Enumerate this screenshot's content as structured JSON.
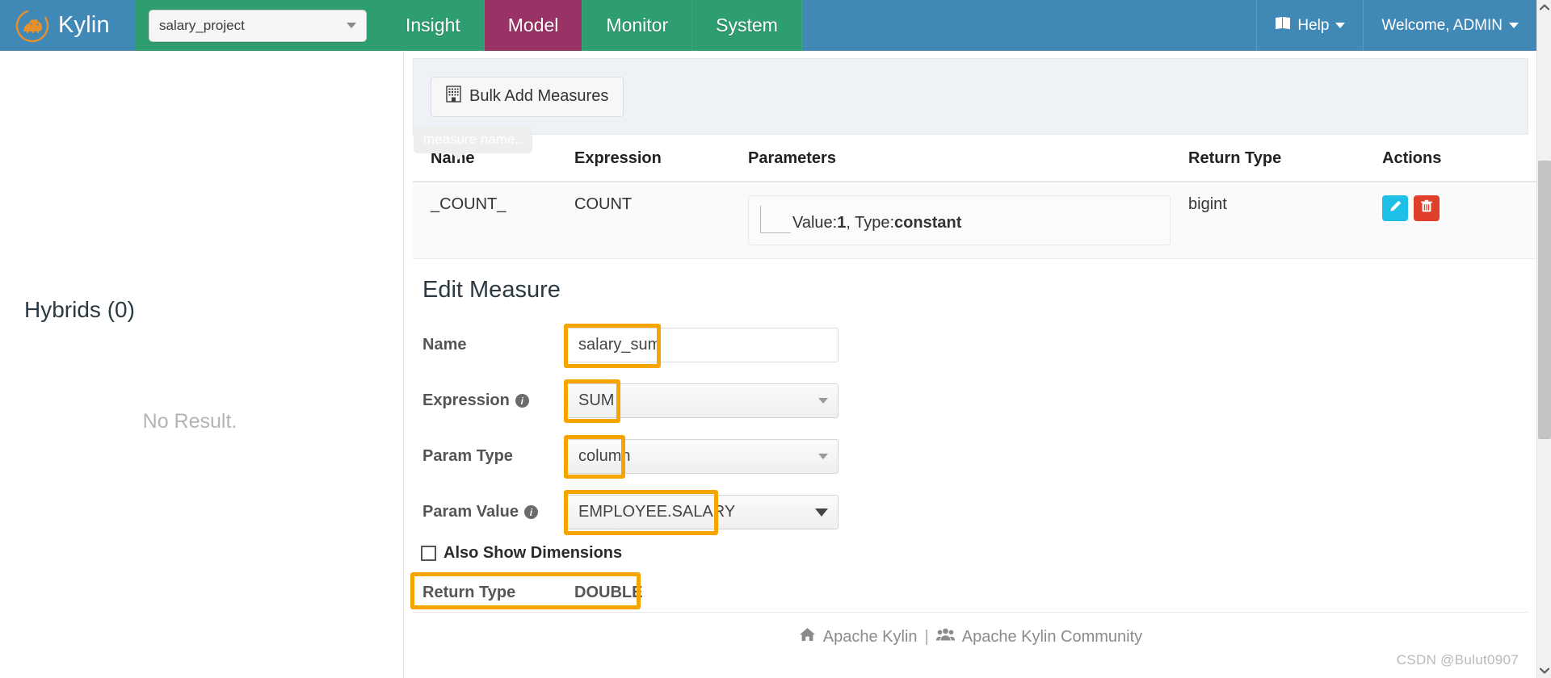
{
  "header": {
    "brand": "Kylin",
    "logo_icon": "kylin-logo-icon",
    "project_select": {
      "value": "salary_project",
      "caret_icon": "chevron-down-icon"
    },
    "tabs": [
      {
        "label": "Insight",
        "active": false
      },
      {
        "label": "Model",
        "active": true
      },
      {
        "label": "Monitor",
        "active": false
      },
      {
        "label": "System",
        "active": false
      }
    ],
    "help": {
      "label": "Help",
      "icon": "book-icon",
      "caret_icon": "chevron-down-icon"
    },
    "user": {
      "label": "Welcome, ADMIN",
      "caret_icon": "chevron-down-icon"
    },
    "colors": {
      "brand_blue": "#4089b7",
      "nav_green": "#2e9e70",
      "active_purple": "#993366",
      "logo_orange": "#e8912a"
    }
  },
  "left_panel": {
    "hybrids_title": "Hybrids (0)",
    "no_result": "No Result."
  },
  "toolbar": {
    "bulk_add_label": "Bulk Add Measures",
    "bulk_add_icon": "building-icon"
  },
  "tooltip": {
    "text": "measure name.."
  },
  "measures_table": {
    "columns": [
      "Name",
      "Expression",
      "Parameters",
      "Return Type",
      "Actions"
    ],
    "rows": [
      {
        "name": "_COUNT_",
        "expression": "COUNT",
        "param_prefix": "Value:",
        "param_value": "1",
        "param_mid": ", Type:",
        "param_type": "constant",
        "return_type": "bigint",
        "actions": [
          {
            "name": "edit-measure-button",
            "icon": "pencil-icon",
            "color": "#1ec0e8"
          },
          {
            "name": "delete-measure-button",
            "icon": "trash-icon",
            "color": "#e0402b"
          }
        ]
      }
    ]
  },
  "edit_measure": {
    "title": "Edit Measure",
    "fields": {
      "name": {
        "label": "Name",
        "value": "salary_sum",
        "highlighted": true
      },
      "expression": {
        "label": "Expression",
        "value": "SUM",
        "info_icon": "info-icon",
        "highlighted": true
      },
      "param_type": {
        "label": "Param Type",
        "value": "column",
        "highlighted": true
      },
      "param_value": {
        "label": "Param Value",
        "value": "EMPLOYEE.SALARY",
        "info_icon": "info-icon",
        "highlighted": true
      }
    },
    "checkbox": {
      "label": "Also Show Dimensions",
      "checked": false
    },
    "return_type": {
      "label": "Return Type",
      "value": "DOUBLE",
      "highlighted": true
    },
    "highlight_color": "#f5a400"
  },
  "footer": {
    "home_icon": "home-icon",
    "link1": "Apache Kylin",
    "separator": "|",
    "group_icon": "users-icon",
    "link2": "Apache Kylin Community"
  },
  "scrollbar": {
    "up_icon": "chevron-up-icon",
    "down_icon": "chevron-down-icon"
  },
  "watermark": "CSDN @Bulut0907"
}
